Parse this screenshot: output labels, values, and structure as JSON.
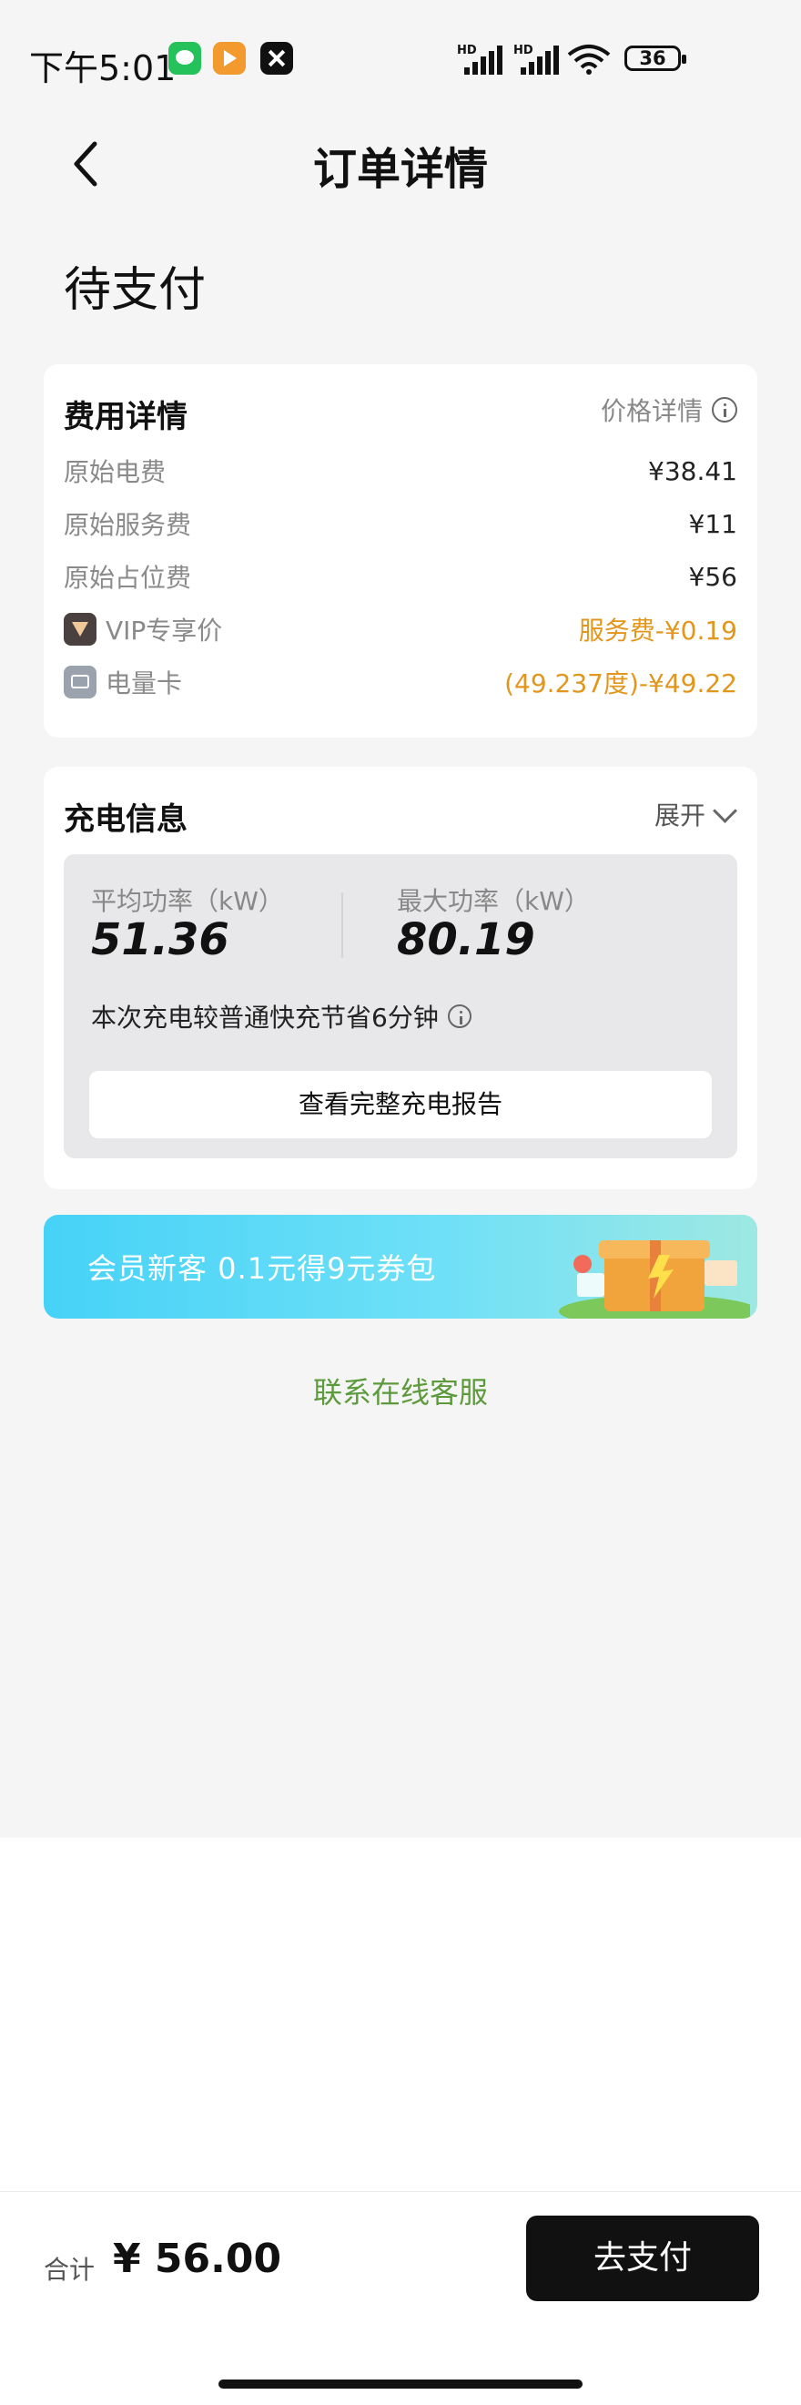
{
  "status_bar": {
    "time": "下午5:01",
    "battery": "36",
    "network_label": "HD"
  },
  "header": {
    "title": "订单详情"
  },
  "order_status": "待支付",
  "fee_card": {
    "title": "费用详情",
    "price_detail_label": "价格详情",
    "rows": [
      {
        "label": "原始电费",
        "value": "¥38.41"
      },
      {
        "label": "原始服务费",
        "value": "¥11"
      },
      {
        "label": "原始占位费",
        "value": "¥56"
      },
      {
        "label": "VIP专享价",
        "value": "服务费-¥0.19"
      },
      {
        "label": "电量卡",
        "value": "(49.237度)-¥49.22"
      }
    ]
  },
  "charge_card": {
    "title": "充电信息",
    "expand_label": "展开",
    "avg_power_label": "平均功率（kW）",
    "avg_power_value": "51.36",
    "max_power_label": "最大功率（kW）",
    "max_power_value": "80.19",
    "saving_note": "本次充电较普通快充节省6分钟",
    "report_button": "查看完整充电报告"
  },
  "promo": {
    "text": "会员新客 0.1元得9元券包"
  },
  "service_link": "联系在线客服",
  "bottom_bar": {
    "total_label": "合计",
    "total_value": "¥ 56.00",
    "pay_button": "去支付"
  },
  "colors": {
    "accent_orange": "#e3961c",
    "link_green": "#5c9a3c",
    "promo_blue": "#46d2f7",
    "pay_button_bg": "#111111"
  }
}
